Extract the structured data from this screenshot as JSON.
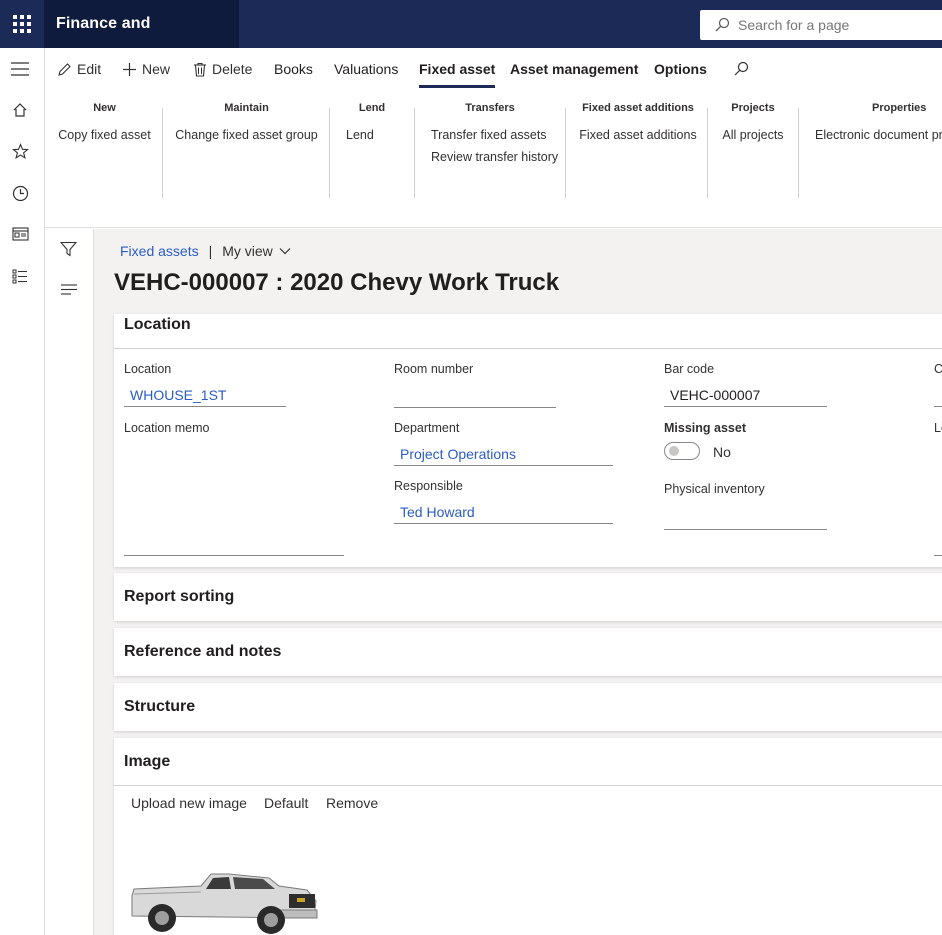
{
  "app": {
    "title": "Finance and Operations"
  },
  "search": {
    "placeholder": "Search for a page"
  },
  "actions": {
    "edit": "Edit",
    "new": "New",
    "delete": "Delete",
    "tabs": [
      "Books",
      "Valuations",
      "Fixed asset",
      "Asset management",
      "Options"
    ]
  },
  "ribbon": {
    "groups": [
      {
        "title": "New",
        "items": [
          "Copy fixed asset"
        ]
      },
      {
        "title": "Maintain",
        "items": [
          "Change fixed asset group"
        ]
      },
      {
        "title": "Lend",
        "items": [
          "Lend"
        ]
      },
      {
        "title": "Transfers",
        "items": [
          "Transfer fixed assets",
          "Review transfer history"
        ]
      },
      {
        "title": "Fixed asset additions",
        "items": [
          "Fixed asset additions"
        ]
      },
      {
        "title": "Projects",
        "items": [
          "All projects"
        ]
      },
      {
        "title": "Properties",
        "items": [
          "Electronic document pro"
        ]
      }
    ]
  },
  "breadcrumb": {
    "link": "Fixed assets",
    "separator": "|",
    "view": "My view"
  },
  "page": {
    "title": "VEHC-000007 : 2020 Chevy Work Truck"
  },
  "location_section": {
    "header": "Location",
    "location_label": "Location",
    "location_value": "WHOUSE_1ST",
    "location_memo_label": "Location memo",
    "room_number_label": "Room number",
    "room_number_value": "",
    "department_label": "Department",
    "department_value": "Project Operations",
    "responsible_label": "Responsible",
    "responsible_value": "Ted Howard",
    "bar_code_label": "Bar code",
    "bar_code_value": "VEHC-000007",
    "missing_asset_label": "Missing asset",
    "missing_asset_value": "No",
    "physical_inventory_label": "Physical inventory",
    "col4_label_1": "C",
    "col4_label_2": "Lo"
  },
  "sections": {
    "report_sorting": "Report sorting",
    "reference_notes": "Reference and notes",
    "structure": "Structure",
    "image": "Image"
  },
  "image_section": {
    "upload": "Upload new image",
    "default": "Default",
    "remove": "Remove"
  }
}
